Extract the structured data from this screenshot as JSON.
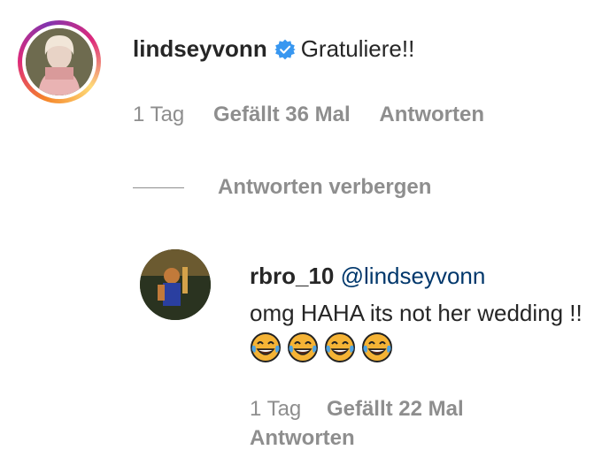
{
  "comments": [
    {
      "username": "lindseyvonn",
      "verified": true,
      "text": "Gratuliere!!",
      "time": "1 Tag",
      "likes": "Gefällt 36 Mal",
      "reply_label": "Antworten",
      "hide_replies_label": "Antworten verbergen"
    }
  ],
  "reply": {
    "username": "rbro_10",
    "mention": "@lindseyvonn",
    "text": "omg HAHA its not her wedding !!",
    "emoji": [
      "face-with-tears-of-joy",
      "face-with-tears-of-joy",
      "face-with-tears-of-joy",
      "face-with-tears-of-joy"
    ],
    "time": "1 Tag",
    "likes": "Gefällt 22 Mal",
    "reply_label": "Antworten"
  },
  "colors": {
    "text": "#262626",
    "muted": "#8e8e8e",
    "mention": "#00376b",
    "verified": "#3897f0"
  }
}
